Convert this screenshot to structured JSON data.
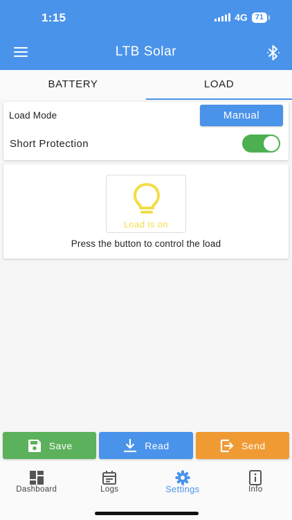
{
  "status_bar": {
    "time": "1:15",
    "network": "4G",
    "battery": "71"
  },
  "appbar": {
    "title": "LTB Solar",
    "menu_icon": "hamburger-icon",
    "bluetooth_icon": "bluetooth-icon"
  },
  "tabs": [
    {
      "label": "BATTERY",
      "active": false
    },
    {
      "label": "LOAD",
      "active": true
    }
  ],
  "load_settings": {
    "load_mode_label": "Load Mode",
    "load_mode_value": "Manual",
    "short_protection_label": "Short Protection",
    "short_protection_on": true
  },
  "load_control": {
    "bulb_icon": "lightbulb-icon",
    "status_text": "Load is on",
    "hint": "Press the button to control the load"
  },
  "actions": {
    "save_label": "Save",
    "read_label": "Read",
    "send_label": "Send"
  },
  "bottom_nav": [
    {
      "label": "Dashboard",
      "icon": "dashboard-icon",
      "active": false
    },
    {
      "label": "Logs",
      "icon": "calendar-icon",
      "active": false
    },
    {
      "label": "Settings",
      "icon": "gear-icon",
      "active": true
    },
    {
      "label": "Info",
      "icon": "info-icon",
      "active": false
    }
  ],
  "colors": {
    "primary": "#4a93ea",
    "save": "#5cb15c",
    "send": "#f09a34",
    "toggle_on": "#4caf50",
    "bulb": "#f3dd45"
  }
}
